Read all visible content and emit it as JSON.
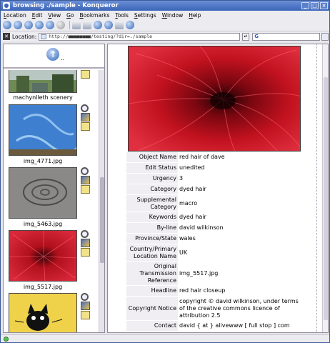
{
  "window": {
    "title": "browsing ./sample - Konqueror"
  },
  "menu": [
    "Location",
    "Edit",
    "View",
    "Go",
    "Bookmarks",
    "Tools",
    "Settings",
    "Window",
    "Help"
  ],
  "location": {
    "label": "Location:",
    "url": "http://■■■■■■■■/testing/?dir=./sample",
    "search_prefix": "G"
  },
  "left": {
    "up_label": "..",
    "items": [
      {
        "label": "machynlleth scenery"
      },
      {
        "label": "img_4771.jpg"
      },
      {
        "label": "img_5463.jpg"
      },
      {
        "label": "img_5517.jpg"
      },
      {
        "label": ""
      }
    ]
  },
  "metadata": [
    {
      "key": "Object Name",
      "value": "red hair of dave"
    },
    {
      "key": "Edit Status",
      "value": "unedited"
    },
    {
      "key": "Urgency",
      "value": "3"
    },
    {
      "key": "Category",
      "value": "dyed hair"
    },
    {
      "key": "Supplemental Category",
      "value": "macro"
    },
    {
      "key": "Keywords",
      "value": "dyed hair"
    },
    {
      "key": "By-line",
      "value": "david wilkinson"
    },
    {
      "key": "Province/State",
      "value": "wales"
    },
    {
      "key": "Country/Primary Location Name",
      "value": "UK"
    },
    {
      "key": "Original Transmission Reference",
      "value": "img_5517.jpg"
    },
    {
      "key": "Headline",
      "value": "red hair closeup"
    },
    {
      "key": "Copyright Notice",
      "value": "copyright © david wilkinson, under terms of the creative commons licence of attribution 2.5"
    },
    {
      "key": "Contact",
      "value": "david { at } alivewww [ full stop ] com"
    }
  ]
}
